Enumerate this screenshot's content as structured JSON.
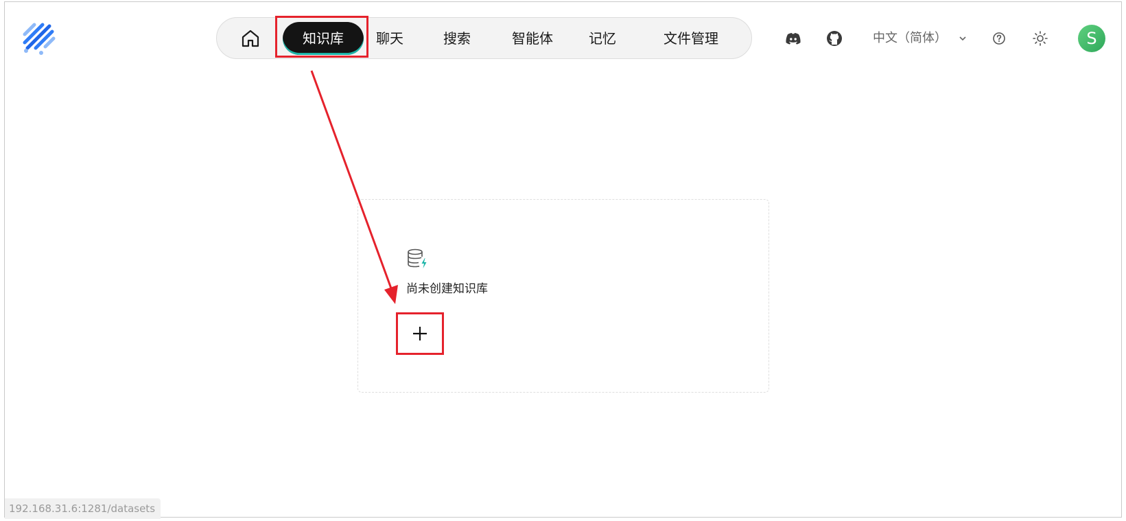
{
  "nav": {
    "items": [
      {
        "label": "知识库",
        "active": true
      },
      {
        "label": "聊天"
      },
      {
        "label": "搜索"
      },
      {
        "label": "智能体"
      },
      {
        "label": "记忆"
      },
      {
        "label": "文件管理"
      }
    ]
  },
  "header": {
    "language": "中文（简体）",
    "avatar_initial": "S"
  },
  "empty_state": {
    "message": "尚未创建知识库",
    "add_label": "+"
  },
  "status_bar": {
    "url": "192.168.31.6:1281/datasets"
  },
  "colors": {
    "annotation_red": "#e5222c",
    "active_tab_bg": "#141414",
    "accent_teal": "#1bb5a8",
    "logo_blue": "#2f7cf6"
  }
}
